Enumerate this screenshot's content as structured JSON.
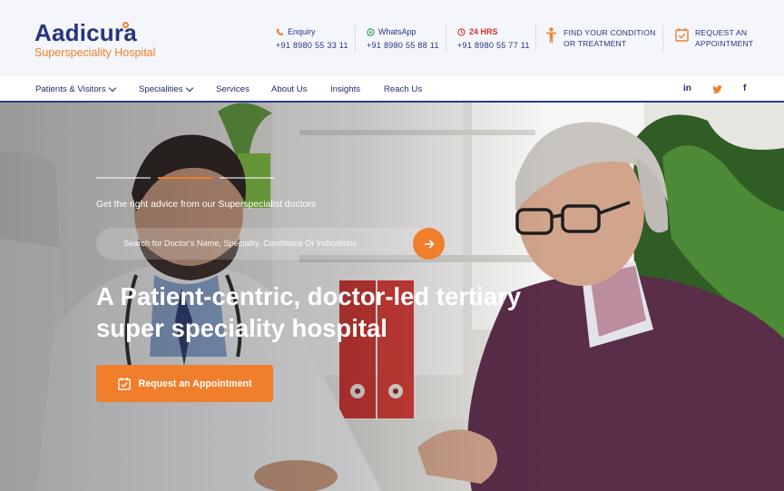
{
  "brand": {
    "name": "Aadicura",
    "tagline": "Superspeciality Hospital",
    "colors": {
      "primary": "#28347f",
      "accent": "#f07f2d",
      "alert": "#d9302b"
    }
  },
  "contacts": [
    {
      "label": "Enquiry",
      "number": "+91 8980 55 33 11",
      "icon": "phone-icon"
    },
    {
      "label": "WhatsApp",
      "number": "+91 8980 55 88 11",
      "icon": "whatsapp-icon"
    },
    {
      "label": "24 HRS",
      "number": "+91 8980 55 77 11",
      "icon": "clock-icon"
    }
  ],
  "top_ctas": {
    "find_line1": "FIND YOUR CONDITION",
    "find_line2": "OR TREATMENT",
    "appointment_line1": "REQUEST AN",
    "appointment_line2": "APPOINTMENT"
  },
  "nav": {
    "items": [
      {
        "label": "Patients & Visitors",
        "dropdown": true
      },
      {
        "label": "Specialities",
        "dropdown": true
      },
      {
        "label": "Services",
        "dropdown": false
      },
      {
        "label": "About Us",
        "dropdown": false
      },
      {
        "label": "Insights",
        "dropdown": false
      },
      {
        "label": "Reach Us",
        "dropdown": false
      }
    ],
    "social": [
      {
        "label": "in",
        "icon": "linkedin-icon"
      },
      {
        "label": "twitter",
        "icon": "twitter-icon"
      },
      {
        "label": "f",
        "icon": "facebook-icon"
      }
    ]
  },
  "hero": {
    "advice": "Get the right advice from our Superspecialist doctors",
    "search_placeholder": "Search for Doctor's Name, Speciality, Conditions Or Indications",
    "headline_line1": "A Patient-centric, doctor-led tertiary",
    "headline_line2": "super speciality hospital",
    "cta": "Request an Appointment",
    "slides": {
      "total": 3,
      "active": 2
    }
  }
}
